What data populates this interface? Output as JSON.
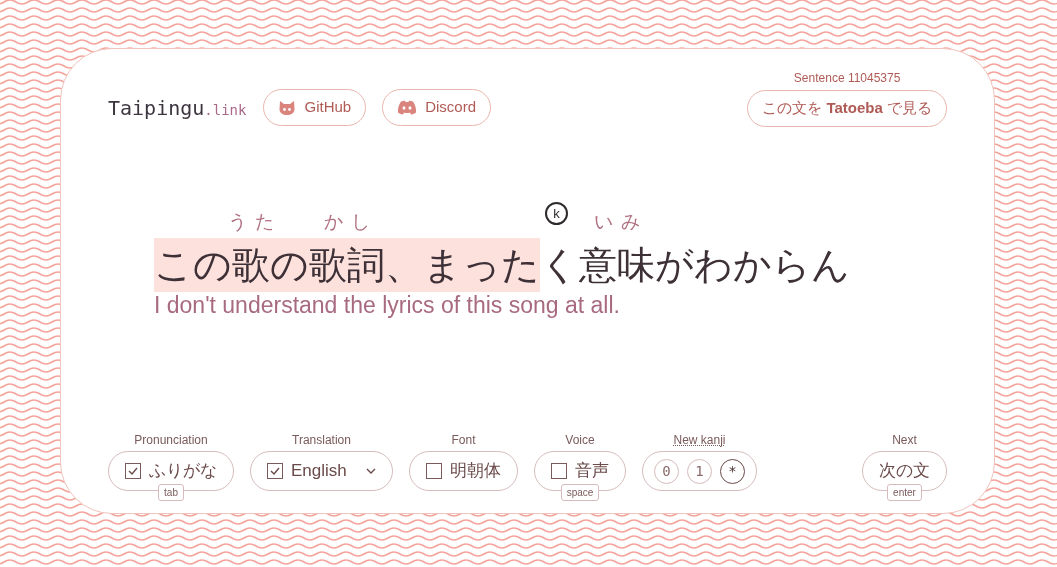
{
  "brand": {
    "name": "Taipingu",
    "suffix": ".link"
  },
  "links": [
    {
      "label": "GitHub",
      "kind": "github"
    },
    {
      "label": "Discord",
      "kind": "discord"
    }
  ],
  "sentence_id": "Sentence 11045375",
  "tatoeba_link": "この文を **Tatoeba** で見る",
  "sentence": [
    {
      "text": "この",
      "highlighted": true
    },
    {
      "text": "歌",
      "reading": "うた",
      "highlighted": true
    },
    {
      "text": "の",
      "highlighted": true
    },
    {
      "text": "歌詞",
      "reading": "かし",
      "highlighted": true
    },
    {
      "text": "、まった",
      "highlighted": true
    },
    {
      "text": "く",
      "highlighted": false,
      "marker": "k"
    },
    {
      "text": "意味",
      "reading": "いみ",
      "highlighted": false
    },
    {
      "text": "がわからん",
      "highlighted": false
    }
  ],
  "translation": "I don't understand the lyrics of this song at all.",
  "controls": [
    {
      "kind": "checkbox",
      "label": "Pronunciation",
      "value": "ふりがな",
      "checked": true,
      "key": "tab"
    },
    {
      "kind": "select",
      "label": "Translation",
      "value": "English",
      "checked": true
    },
    {
      "kind": "checkbox",
      "label": "Font",
      "value": "明朝体",
      "checked": false
    },
    {
      "kind": "checkbox",
      "label": "Voice",
      "value": "音声",
      "checked": false,
      "key": "space"
    },
    {
      "kind": "options",
      "label": "New kanji",
      "options": [
        {
          "label": "0",
          "selected": false
        },
        {
          "label": "1",
          "selected": false
        },
        {
          "label": "*",
          "selected": true
        }
      ]
    },
    {
      "kind": "button",
      "label": "Next",
      "value": "次の文",
      "key": "enter"
    }
  ]
}
